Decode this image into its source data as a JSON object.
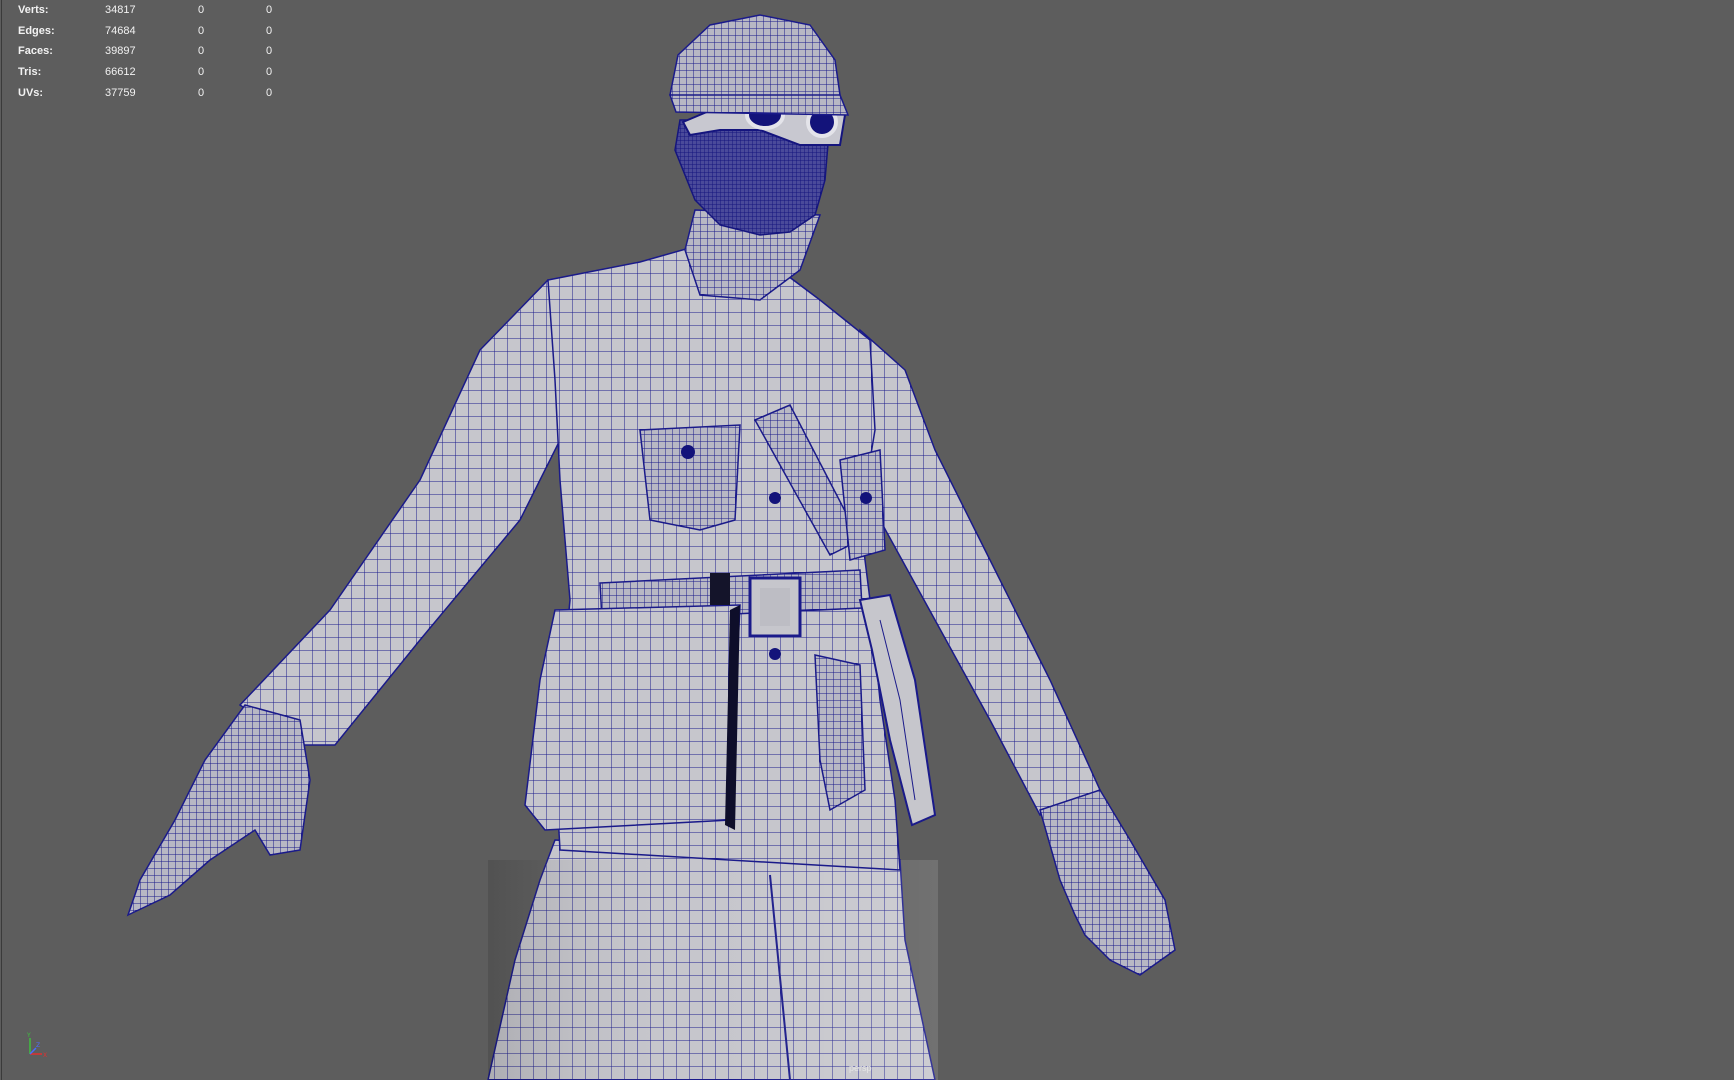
{
  "hud": {
    "rows": [
      {
        "label": "Verts:",
        "total": "34817",
        "selected": "0",
        "component": "0"
      },
      {
        "label": "Edges:",
        "total": "74684",
        "selected": "0",
        "component": "0"
      },
      {
        "label": "Faces:",
        "total": "39897",
        "selected": "0",
        "component": "0"
      },
      {
        "label": "Tris:",
        "total": "66612",
        "selected": "0",
        "component": "0"
      },
      {
        "label": "UVs:",
        "total": "37759",
        "selected": "0",
        "component": "0"
      }
    ]
  },
  "viewport": {
    "camera": "persp",
    "background_color": "#5d5d5d",
    "wireframe_color": "#1a1a8c",
    "shaded_color": "#c7c7cc"
  },
  "axis_gizmo": {
    "y_label": "Y",
    "z_label": "Z",
    "x_label": "X",
    "y_color": "#3fbf3f",
    "z_color": "#4a6cff",
    "x_color": "#e03030"
  }
}
